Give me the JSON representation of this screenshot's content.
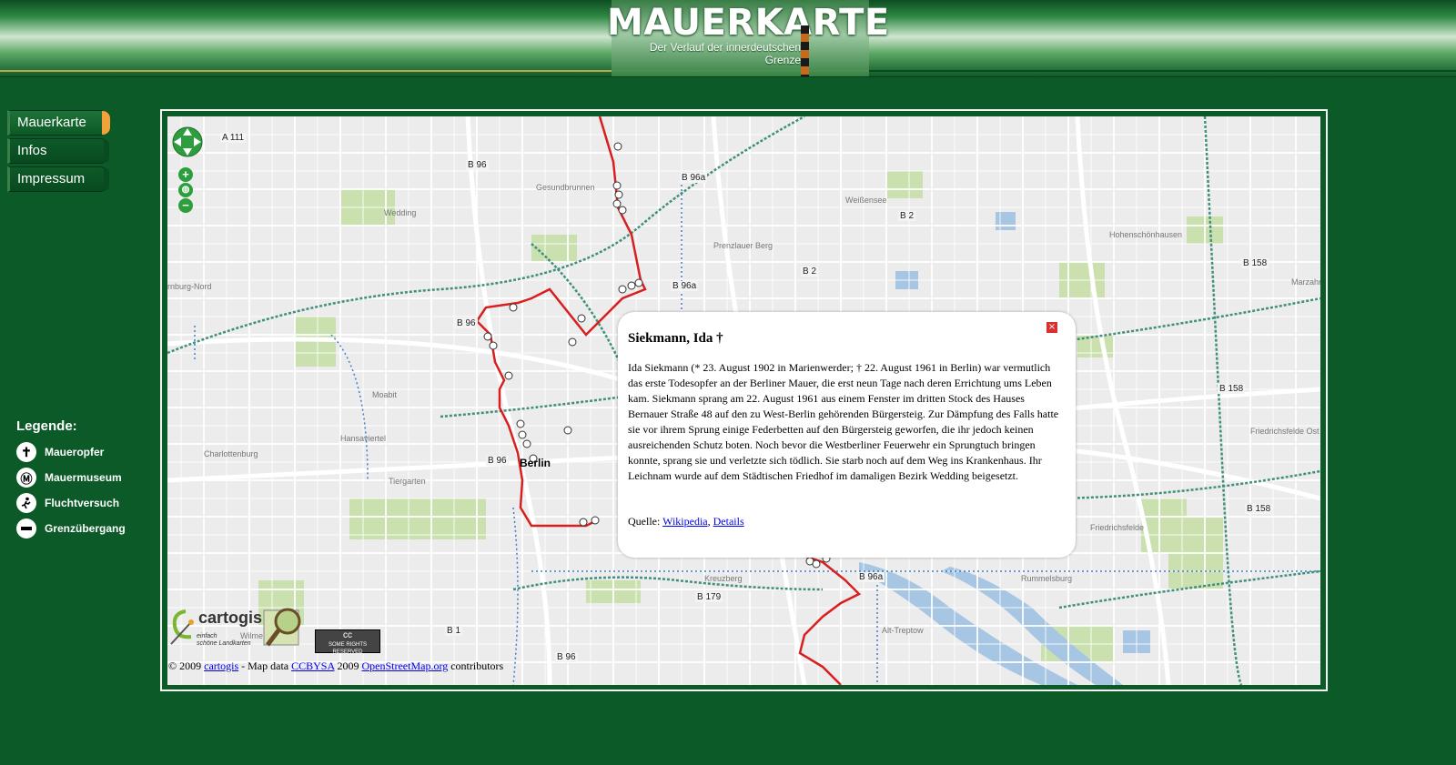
{
  "header": {
    "title": "MAUERKARTE",
    "subtitle_line1": "Der Verlauf der innerdeutschen",
    "subtitle_line2": "Grenze"
  },
  "nav": {
    "items": [
      {
        "label": "Mauerkarte",
        "active": true
      },
      {
        "label": "Infos",
        "active": false
      },
      {
        "label": "Impressum",
        "active": false
      }
    ]
  },
  "legend": {
    "title": "Legende:",
    "items": [
      {
        "label": "Maueropfer",
        "icon": "cross-icon"
      },
      {
        "label": "Mauermuseum",
        "icon": "museum-icon"
      },
      {
        "label": "Fluchtversuch",
        "icon": "runner-icon"
      },
      {
        "label": "Grenzübergang",
        "icon": "crossing-icon"
      }
    ]
  },
  "map": {
    "road_labels": [
      "B 96",
      "B 96a",
      "B 96a",
      "B 2",
      "B 2",
      "B 96",
      "B 158",
      "B 158",
      "B 158",
      "B 96",
      "B 96a",
      "B 179",
      "B 1",
      "B 96",
      "A 111"
    ],
    "place_labels": [
      "Gesundbrunnen",
      "Wedding",
      "Weißensee",
      "Prenzlauer Berg",
      "Hohenschönhausen",
      "Marzahn",
      "Moabit",
      "Hansaviertel",
      "Charlottenburg",
      "Tiergarten",
      "Kreuzberg",
      "Friedrichsfelde Ost",
      "Friedrichsfelde",
      "Rummelsburg",
      "Alt-Treptow",
      "Wilmersdorf",
      "rnburg-Nord"
    ],
    "city_label": "Berlin",
    "controls": {
      "zoom_in": "+",
      "zoom_out": "−"
    }
  },
  "popup": {
    "title": "Siekmann, Ida †",
    "body": "Ida Siekmann (* 23. August 1902 in Marienwerder; † 22. August 1961 in Berlin) war vermutlich das erste Todesopfer an der Berliner Mauer, die erst neun Tage nach deren Errichtung ums Leben kam. Siekmann sprang am 22. August 1961 aus einem Fenster im dritten Stock des Hauses Bernauer Straße 48 auf den zu West-Berlin gehörenden Bürgersteig. Zur Dämpfung des Falls hatte sie vor ihrem Sprung einige Federbetten auf den Bürgersteig geworfen, die ihr jedoch keinen ausreichenden Schutz boten. Noch bevor die Westberliner Feuerwehr ein Sprungtuch bringen konnte, sprang sie und verletzte sich tödlich. Sie starb noch auf dem Weg ins Krankenhaus. Ihr Leichnam wurde auf dem Städtischen Friedhof im damaligen Bezirk Wedding beigesetzt.",
    "source_label": "Quelle:",
    "link_wikipedia": "Wikipedia",
    "separator": ",",
    "link_details": "Details",
    "close": "×"
  },
  "attribution": {
    "copyright": "© 2009",
    "cartogis_link": "cartogis",
    "map_data": "- Map data",
    "ccbysa_link": "CCBYSA",
    "year": "2009",
    "osm_link": "OpenStreetMap.org",
    "contributors": "contributors",
    "cartogis_logo_name": "cartogis",
    "cartogis_tagline1": "einfach",
    "cartogis_tagline2": "schöne Landkarten",
    "cc_badge_text": "SOME RIGHTS RESERVED",
    "cc_badge_symbol": "cc"
  },
  "colors": {
    "background": "#0b5a27",
    "accent_orange": "#f3a23a",
    "wall_line": "#d81e1e",
    "map_control": "#2e9d3e",
    "link": "#0000ee"
  }
}
